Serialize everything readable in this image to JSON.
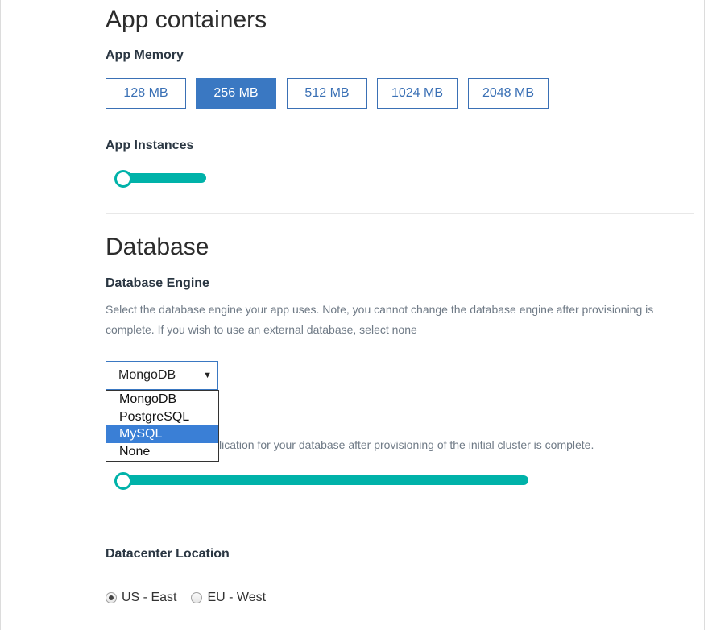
{
  "app_containers": {
    "title": "App containers",
    "memory": {
      "label": "App Memory",
      "options": [
        "128 MB",
        "256 MB",
        "512 MB",
        "1024 MB",
        "2048 MB"
      ],
      "selected": "256 MB"
    },
    "instances": {
      "label": "App Instances",
      "value_fraction": 0
    }
  },
  "database": {
    "title": "Database",
    "engine": {
      "label": "Database Engine",
      "description": "Select the database engine your app uses. Note, you cannot change the database engine after provisioning is complete. If you wish to use an external database, select none",
      "selected": "MongoDB",
      "options": [
        "MongoDB",
        "PostgreSQL",
        "MySQL",
        "None"
      ],
      "highlighted_option": "MySQL"
    },
    "replication": {
      "partial_text": "lication for your database after provisioning of the initial cluster is complete.",
      "value_fraction": 0
    }
  },
  "datacenter": {
    "label": "Datacenter Location",
    "options": [
      "US - East",
      "EU - West"
    ],
    "selected": "US - East"
  },
  "colors": {
    "accent": "#3a78c2",
    "slider": "#00b2a9",
    "highlight": "#3a7fd6"
  }
}
